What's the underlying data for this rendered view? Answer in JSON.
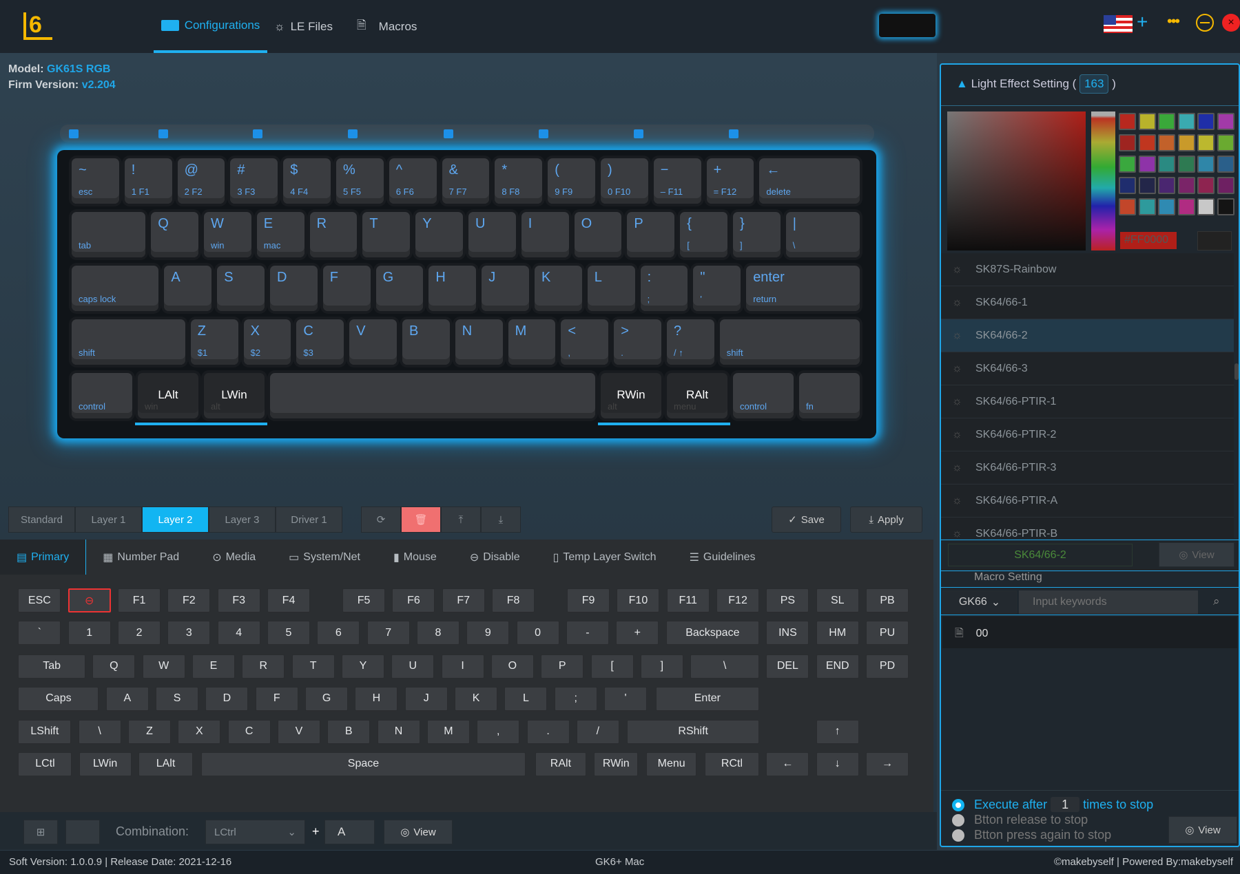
{
  "header": {
    "nav": [
      {
        "label": "Configurations",
        "icon": "keyboard-icon",
        "active": true
      },
      {
        "label": "LE Files",
        "icon": "lightbulb-icon"
      },
      {
        "label": "Macros",
        "icon": "document-icon"
      }
    ],
    "icons": [
      "keyboard-device-icon",
      "us-flag-icon",
      "plus-icon",
      "more-icon",
      "minimize-icon",
      "close-icon"
    ]
  },
  "device": {
    "model_label": "Model:",
    "model": "GK61S RGB",
    "firm_label": "Firm Version:",
    "firm": "v2.204"
  },
  "keyboard_visual": {
    "rows": [
      [
        [
          "~",
          "esc"
        ],
        [
          "!",
          "1  F1"
        ],
        [
          "@",
          "2  F2"
        ],
        [
          "#",
          "3  F3"
        ],
        [
          "$",
          "4  F4"
        ],
        [
          "%",
          "5  F5"
        ],
        [
          "^",
          "6  F6"
        ],
        [
          "&",
          "7  F7"
        ],
        [
          "*",
          "8  F8"
        ],
        [
          "(",
          "9  F9"
        ],
        [
          ")",
          "0  F10"
        ],
        [
          "−",
          "–  F11"
        ],
        [
          "+",
          "=  F12"
        ],
        [
          "←",
          "delete"
        ]
      ],
      [
        [
          "",
          "tab"
        ],
        [
          "Q",
          ""
        ],
        [
          "W",
          "win"
        ],
        [
          "E",
          "mac"
        ],
        [
          "R",
          ""
        ],
        [
          "T",
          ""
        ],
        [
          "Y",
          ""
        ],
        [
          "U",
          ""
        ],
        [
          "I",
          ""
        ],
        [
          "O",
          ""
        ],
        [
          "P",
          ""
        ],
        [
          "{",
          "["
        ],
        [
          "}",
          "]"
        ],
        [
          "|",
          "\\"
        ]
      ],
      [
        [
          "",
          "caps lock"
        ],
        [
          "A",
          ""
        ],
        [
          "S",
          ""
        ],
        [
          "D",
          ""
        ],
        [
          "F",
          ""
        ],
        [
          "G",
          ""
        ],
        [
          "H",
          ""
        ],
        [
          "J",
          ""
        ],
        [
          "K",
          ""
        ],
        [
          "L",
          ""
        ],
        [
          ":",
          ";"
        ],
        [
          "\"",
          "'"
        ],
        [
          "enter",
          "return"
        ]
      ],
      [
        [
          "",
          "shift"
        ],
        [
          "Z",
          "$1"
        ],
        [
          "X",
          "$2"
        ],
        [
          "C",
          "$3"
        ],
        [
          "V",
          ""
        ],
        [
          "B",
          ""
        ],
        [
          "N",
          ""
        ],
        [
          "M",
          ""
        ],
        [
          "<",
          ","
        ],
        [
          ">",
          "."
        ],
        [
          "?",
          "/  ↑"
        ],
        [
          "",
          "shift"
        ]
      ],
      [
        [
          "",
          "control"
        ],
        [
          "LAlt",
          "win"
        ],
        [
          "LWin",
          "alt"
        ],
        [
          "",
          ""
        ],
        [
          "RWin",
          "alt"
        ],
        [
          "RAlt",
          "menu"
        ],
        [
          "",
          "control"
        ],
        [
          "",
          "fn"
        ]
      ]
    ],
    "highlighted": [
      "LAlt",
      "LWin",
      "RWin",
      "RAlt"
    ]
  },
  "layers": {
    "tabs": [
      "Standard",
      "Layer 1",
      "Layer 2",
      "Layer 3",
      "Driver 1"
    ],
    "active": "Layer 2",
    "tools": [
      "refresh-icon",
      "delete-icon",
      "upload-icon",
      "download-icon"
    ],
    "save": "Save",
    "apply": "Apply"
  },
  "categories": {
    "tabs": [
      "Primary",
      "Number Pad",
      "Media",
      "System/Net",
      "Mouse",
      "Disable",
      "Temp Layer Switch",
      "Guidelines"
    ],
    "active": "Primary"
  },
  "keys": [
    [
      "ESC",
      "⊖",
      "F1",
      "F2",
      "F3",
      "F4",
      "F5",
      "F6",
      "F7",
      "F8",
      "F9",
      "F10",
      "F11",
      "F12",
      "PS",
      "SL",
      "PB"
    ],
    [
      "`",
      "1",
      "2",
      "3",
      "4",
      "5",
      "6",
      "7",
      "8",
      "9",
      "0",
      "-",
      "+",
      "Backspace",
      "INS",
      "HM",
      "PU"
    ],
    [
      "Tab",
      "Q",
      "W",
      "E",
      "R",
      "T",
      "Y",
      "U",
      "I",
      "O",
      "P",
      "[",
      "]",
      "\\",
      "DEL",
      "END",
      "PD"
    ],
    [
      "Caps",
      "A",
      "S",
      "D",
      "F",
      "G",
      "H",
      "J",
      "K",
      "L",
      ";",
      "'",
      "Enter"
    ],
    [
      "LShift",
      "\\",
      "Z",
      "X",
      "C",
      "V",
      "B",
      "N",
      "M",
      ",",
      ".",
      "/",
      "RShift",
      "↑"
    ],
    [
      "LCtl",
      "LWin",
      "LAlt",
      "Space",
      "RAlt",
      "RWin",
      "Menu",
      "RCtl",
      "←",
      "↓",
      "→"
    ]
  ],
  "combo": {
    "label": "Combination:",
    "modifier": "LCtrl",
    "plus": "+",
    "key": "A",
    "view": "View"
  },
  "status": {
    "left": "Soft Version: 1.0.0.9 | Release Date: 2021-12-16",
    "center": "GK6+ Mac",
    "right": "©makebyself | Powered By:makebyself"
  },
  "light": {
    "title": "Light Effect Setting (",
    "count": "163",
    "close": ")",
    "hex": "#FF0000",
    "palette": [
      "#b8281f",
      "#b9b22b",
      "#3aa83a",
      "#3aaab0",
      "#1f2ea8",
      "#a23aa8",
      "#9e2420",
      "#c0361f",
      "#c2612a",
      "#c99a2a",
      "#bcb82e",
      "#6aaa30",
      "#3aa83e",
      "#8e33a8",
      "#2a8a82",
      "#2e7a52",
      "#2f86a8",
      "#2a5f8a",
      "#1f2d6e",
      "#232649",
      "#4a2670",
      "#7a2468",
      "#8e2450",
      "#6e2062",
      "#c2462a",
      "#2e9a9c",
      "#2f8ab2",
      "#b02c82",
      "#c8c8c8",
      "#141414"
    ],
    "effects": [
      "SK87S-Rainbow",
      "SK64/66-1",
      "SK64/66-2",
      "SK64/66-3",
      "SK64/66-PTIR-1",
      "SK64/66-PTIR-2",
      "SK64/66-PTIR-3",
      "SK64/66-PTIR-A",
      "SK64/66-PTIR-B"
    ],
    "selected": "SK64/66-2",
    "current": "SK64/66-2",
    "view": "View"
  },
  "macro": {
    "title": "Macro Setting",
    "group": "GK66",
    "search_placeholder": "Input keywords",
    "files": [
      "00"
    ],
    "option1_pre": "Execute after",
    "repeat": "1",
    "option1_post": "times to stop",
    "option2": "Btton release to stop",
    "option3": "Btton press again to stop",
    "view": "View"
  }
}
